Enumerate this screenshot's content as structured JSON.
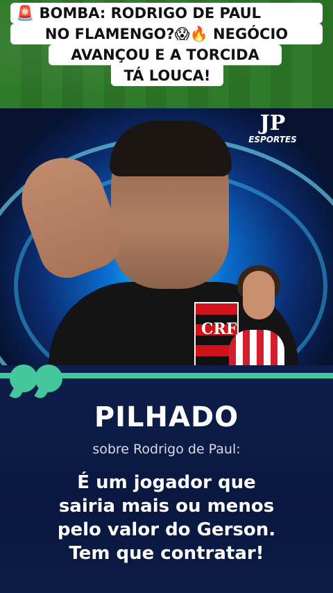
{
  "headline": {
    "line1": "🚨 BOMBA: RODRIGO DE PAUL",
    "line2": "NO FLAMENGO?😱🔥 NEGÓCIO",
    "line3": "AVANÇOU E A TORCIDA",
    "line4": "TÁ LOUCA!"
  },
  "video": {
    "channel_logo": "JP",
    "channel_sub": "ESPORTES",
    "crest_text": "CRF"
  },
  "quote": {
    "speaker": "PILHADO",
    "subtitle": "sobre Rodrigo de Paul:",
    "lines": [
      "É um jogador que",
      "sairia mais ou menos",
      "pelo valor do Gerson.",
      "Tem que contratar!"
    ]
  },
  "colors": {
    "accent_green": "#44c79a",
    "panel_navy": "#0e1e4a",
    "headline_bg": "#ffffff"
  }
}
